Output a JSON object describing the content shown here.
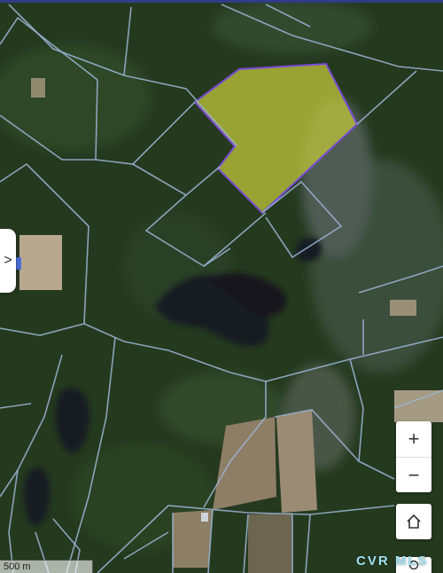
{
  "map": {
    "basemap": "satellite",
    "parcel_line_color": "#9bb6d6",
    "highlight_fill": "#b8c23a",
    "highlight_stroke": "#7a4bd6"
  },
  "controls": {
    "drawer_toggle": ">",
    "zoom_in": "+",
    "zoom_out": "−",
    "home_icon": "home-icon"
  },
  "scale_label": "500 m",
  "attribution": "CVR MLS"
}
